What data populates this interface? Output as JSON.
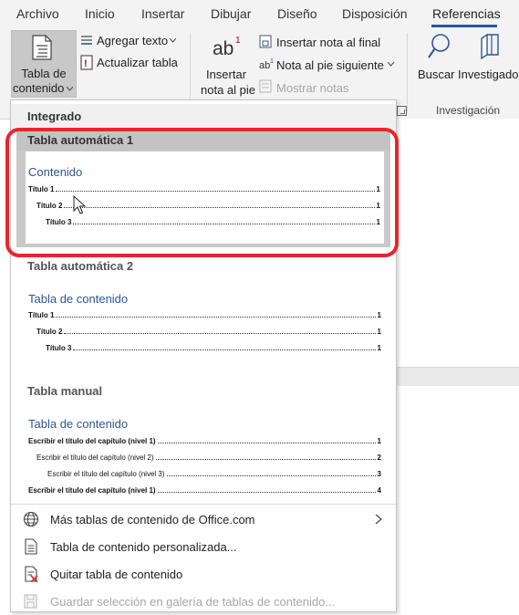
{
  "tabs": [
    "Archivo",
    "Inicio",
    "Insertar",
    "Dibujar",
    "Diseño",
    "Disposición",
    "Referencias"
  ],
  "active_tab": "Referencias",
  "ribbon": {
    "toc_button": {
      "line1": "Tabla de",
      "line2": "contenido"
    },
    "add_text": "Agregar texto",
    "update_table": "Actualizar tabla",
    "footnote_big": {
      "line1": "Insertar",
      "line2": "nota al pie"
    },
    "insert_endnote": "Insertar nota al final",
    "next_footnote": "Nota al pie siguiente",
    "show_notes": "Mostrar notas",
    "search": "Buscar",
    "researcher": "Investigador",
    "group_research": "Investigación",
    "accent_color": "#2b579a"
  },
  "gallery": {
    "section": "Integrado",
    "items": [
      {
        "name": "Tabla automática 1",
        "preview_title": "Contenido",
        "rows": [
          {
            "label": "Título 1",
            "page": "1"
          },
          {
            "label": "Título 2",
            "page": "1"
          },
          {
            "label": "Título 3",
            "page": "1"
          }
        ]
      },
      {
        "name": "Tabla automática 2",
        "preview_title": "Tabla de contenido",
        "rows": [
          {
            "label": "Título 1",
            "page": "1"
          },
          {
            "label": "Título 2",
            "page": "1"
          },
          {
            "label": "Título 3",
            "page": "1"
          }
        ]
      },
      {
        "name": "Tabla manual",
        "preview_title": "Tabla de contenido",
        "rows": [
          {
            "label": "Escribir el título del capítulo (nivel 1)",
            "page": "1"
          },
          {
            "label": "Escribir el título del capítulo (nivel 2)",
            "page": "2"
          },
          {
            "label": "Escribir el título del capítulo (nivel 3)",
            "page": "3"
          },
          {
            "label": "Escribir el título del capítulo (nivel 1)",
            "page": "4"
          }
        ]
      }
    ],
    "highlight_color": "#e8252b"
  },
  "menu": [
    {
      "label": "Más tablas de contenido de Office.com",
      "icon": "globe-icon",
      "enabled": true,
      "submenu": true
    },
    {
      "label": "Tabla de contenido personalizada...",
      "icon": "document-icon",
      "enabled": true,
      "submenu": false
    },
    {
      "label": "Quitar tabla de contenido",
      "icon": "remove-document-icon",
      "enabled": true,
      "submenu": false
    },
    {
      "label": "Guardar selección en galería de tablas de contenido...",
      "icon": "save-to-gallery-icon",
      "enabled": false,
      "submenu": false
    }
  ]
}
